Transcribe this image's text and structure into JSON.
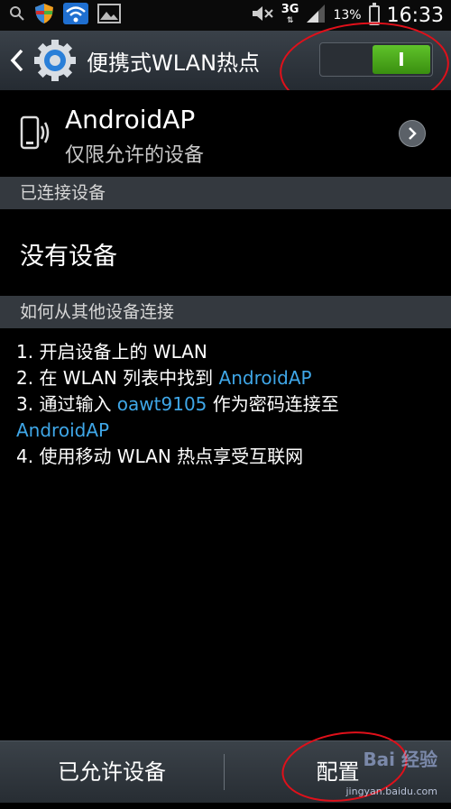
{
  "status_bar": {
    "network": "3G",
    "battery_percent": "13%",
    "battery_level": 0.13,
    "time": "16:33",
    "icons": [
      "search-icon",
      "shield-icon",
      "wifi-icon",
      "image-icon",
      "mute-icon",
      "signal-icon",
      "battery-icon"
    ]
  },
  "action_bar": {
    "title": "便携式WLAN热点",
    "toggle_label": "I",
    "toggle_on": true,
    "accent": "#4bb21d"
  },
  "hotspot": {
    "name": "AndroidAP",
    "subtitle": "仅限允许的设备"
  },
  "connected": {
    "header": "已连接设备",
    "empty_text": "没有设备"
  },
  "howto": {
    "header": "如何从其他设备连接",
    "step1": "1. 开启设备上的 WLAN",
    "step2_prefix": "2. 在 WLAN 列表中找到 ",
    "step2_link": "AndroidAP",
    "step3_prefix": "3. 通过输入 ",
    "step3_password": "oawt9105",
    "step3_suffix": " 作为密码连接至",
    "step3_link": "AndroidAP",
    "step4": "4. 使用移动 WLAN 热点享受互联网",
    "link_color": "#3fa7e8"
  },
  "bottom_bar": {
    "allowed_devices": "已允许设备",
    "configure": "配置"
  },
  "watermark": {
    "brand": "Bai 经验",
    "url": "jingyan.baidu.com"
  }
}
